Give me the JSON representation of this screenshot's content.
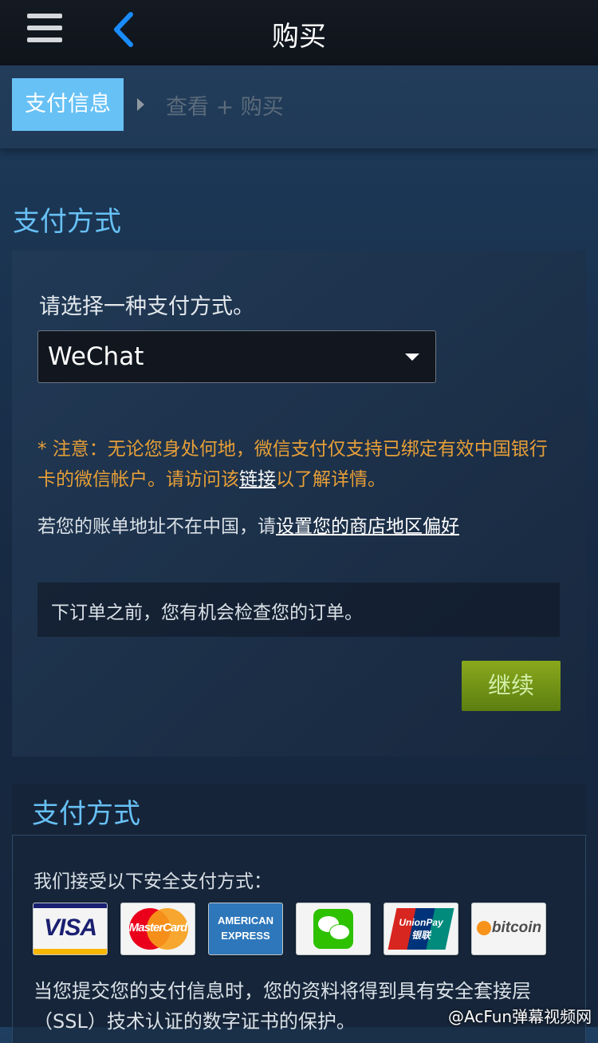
{
  "header": {
    "title": "购买"
  },
  "steps": {
    "active": "支付信息",
    "next": "查看 + 购买"
  },
  "payment": {
    "section_title": "支付方式",
    "choose_label": "请选择一种支付方式。",
    "selected_method": "WeChat",
    "notice_before": "* 注意：无论您身处何地，微信支付仅支持已绑定有效中国银行卡的微信帐户。请访问该",
    "notice_link": "链接",
    "notice_after": "以了解详情。",
    "region_text": "若您的账单地址不在中国，请",
    "region_link": "设置您的商店地区偏好",
    "review_text": "下订单之前，您有机会检查您的订单。",
    "continue_label": "继续"
  },
  "accepted": {
    "section_title": "支付方式",
    "accept_text": "我们接受以下安全支付方式：",
    "cards": [
      {
        "label": "VISA",
        "icon": "visa-icon"
      },
      {
        "label": "MasterCard",
        "icon": "mastercard-icon"
      },
      {
        "label": "AMERICAN EXPRESS",
        "icon": "amex-icon"
      },
      {
        "label": "",
        "icon": "wechat-icon"
      },
      {
        "label": "UnionPay 银联",
        "icon": "unionpay-icon"
      },
      {
        "label": "bitcoin",
        "icon": "bitcoin-icon"
      }
    ],
    "ssl_text": "当您提交您的支付信息时，您的资料将得到具有安全套接层（SSL）技术认证的数字证书的保护。"
  },
  "watermark": "@AcFun弹幕视频网",
  "colors": {
    "accent": "#67c1f5",
    "notice": "#e79f37",
    "button": "#6f9218"
  }
}
